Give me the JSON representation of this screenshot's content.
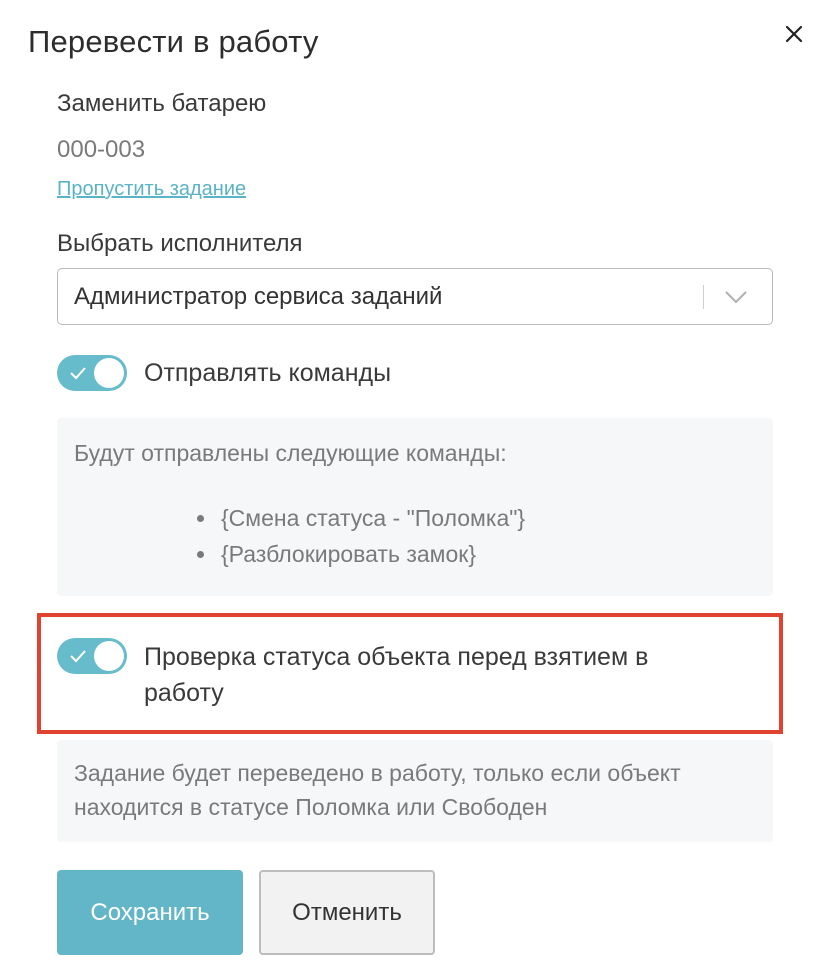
{
  "modal": {
    "title": "Перевести в работу",
    "close_icon": "close-icon"
  },
  "task": {
    "name": "Заменить батарею",
    "code": "000-003",
    "skip_link": "Пропустить задание"
  },
  "assignee": {
    "label": "Выбрать исполнителя",
    "selected_value": "Администратор сервиса заданий",
    "chevron_icon": "chevron-down-icon"
  },
  "send_commands": {
    "label": "Отправлять команды",
    "enabled": true,
    "intro": "Будут отправлены следующие команды:",
    "commands": [
      "{Смена статуса - \"Поломка\"}",
      "{Разблокировать замок}"
    ]
  },
  "status_check": {
    "label_line1": "Проверка статуса объекта перед взятием в",
    "label_line2": "работу",
    "enabled": true,
    "note": "Задание будет переведено в работу, только если объект находится в статусе Поломка или Свободен"
  },
  "actions": {
    "save_label": "Сохранить",
    "cancel_label": "Отменить"
  },
  "colors": {
    "accent": "#63b6c7",
    "toggle_on": "#66bccb",
    "highlight": "#e0432f",
    "link": "#5ab3c6"
  }
}
